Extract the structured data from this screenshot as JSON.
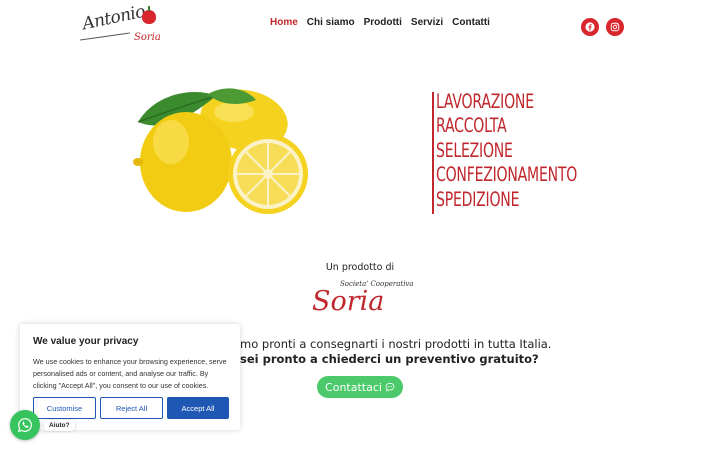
{
  "brand": {
    "logo_script": "Antonio",
    "logo_sub": "Soria"
  },
  "nav": {
    "items": [
      {
        "label": "Home",
        "active": true
      },
      {
        "label": "Chi siamo",
        "active": false
      },
      {
        "label": "Prodotti",
        "active": false
      },
      {
        "label": "Servizi",
        "active": false
      },
      {
        "label": "Contatti",
        "active": false
      }
    ]
  },
  "social": {
    "icons": [
      "facebook-icon",
      "instagram-icon"
    ],
    "color": "#d9262c"
  },
  "hero": {
    "image": "lemons-image",
    "words": [
      "LAVORAZIONE",
      "RACCOLTA",
      "SELEZIONE",
      "CONFEZIONAMENTO",
      "SPEDIZIONE"
    ],
    "accent_color": "#c0282d"
  },
  "product": {
    "label": "Un prodotto di",
    "logo_name": "Soria",
    "logo_caption": "Societa' Cooperativa"
  },
  "message": {
    "line1": "mo pronti a consegnarti i nostri prodotti in tutta Italia.",
    "line2": "sei pronto a chiederci un preventivo gratuito?"
  },
  "cta": {
    "label": "Contattaci",
    "icon": "chat-bubble-icon",
    "color": "#4cc96a"
  },
  "cookie": {
    "title": "We value your privacy",
    "text": "We use cookies to enhance your browsing experience, serve personalised ads or content, and analyse our traffic. By clicking \"Accept All\", you consent to our use of cookies.",
    "customise_label": "Customise",
    "reject_label": "Reject All",
    "accept_label": "Accept All",
    "button_color": "#1f57b5"
  },
  "whatsapp": {
    "label": "Aiuto?",
    "icon": "whatsapp-icon",
    "color": "#37c45e"
  }
}
